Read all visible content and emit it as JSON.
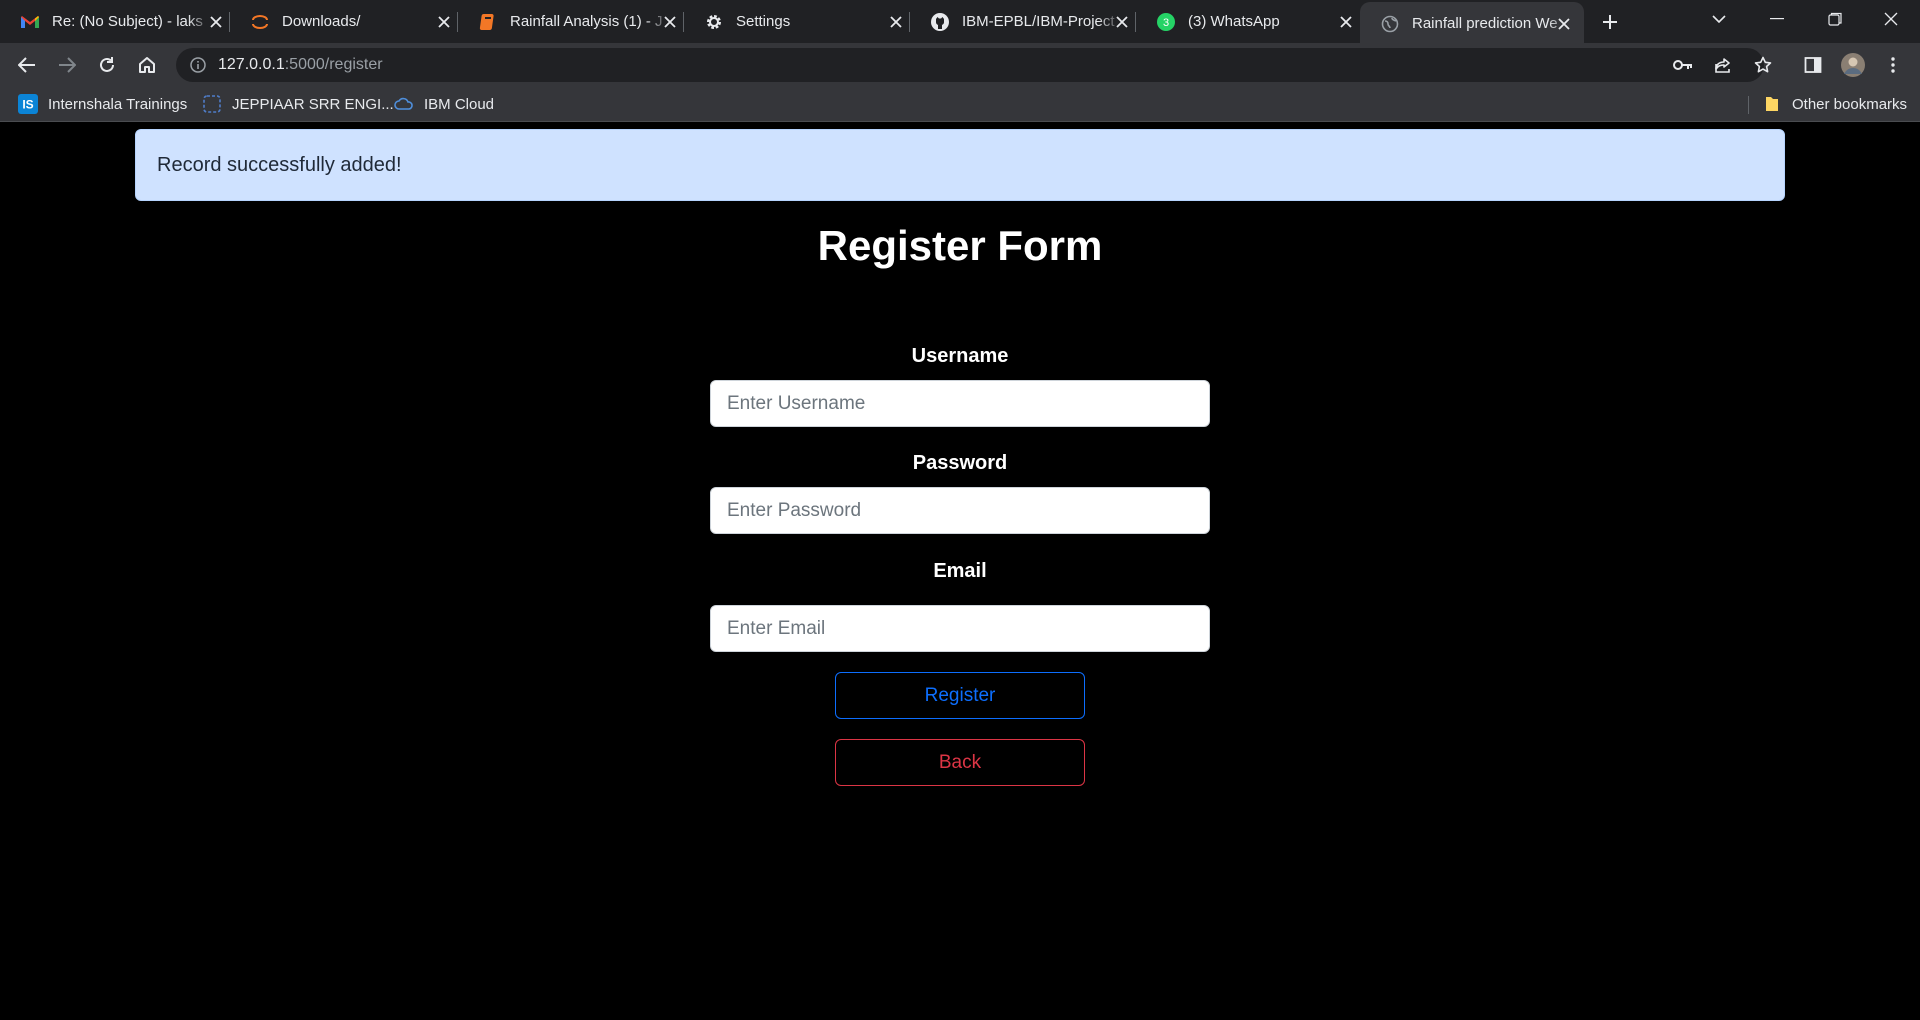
{
  "tabs": [
    {
      "title": "Re: (No Subject) - laks",
      "icon": "gmail-icon"
    },
    {
      "title": "Downloads/",
      "icon": "jupyter-icon"
    },
    {
      "title": "Rainfall Analysis (1) - J",
      "icon": "notebook-icon"
    },
    {
      "title": "Settings",
      "icon": "gear-icon"
    },
    {
      "title": "IBM-EPBL/IBM-Project",
      "icon": "github-icon"
    },
    {
      "title": "(3) WhatsApp",
      "icon": "whatsapp-icon",
      "badge": "3"
    },
    {
      "title": "Rainfall prediction We",
      "icon": "globe-icon",
      "active": true
    }
  ],
  "address_bar": {
    "host": "127.0.0.1",
    "path": ":5000/register"
  },
  "bookmarks": [
    {
      "label": "Internshala Trainings",
      "icon": "internshala-icon",
      "icon_text": "IS"
    },
    {
      "label": "JEPPIAAR SRR ENGI...",
      "icon": "site-icon"
    },
    {
      "label": "IBM Cloud",
      "icon": "ibm-cloud-icon"
    }
  ],
  "other_bookmarks": "Other bookmarks",
  "alert": {
    "message": "Record successfully added!"
  },
  "form": {
    "title": "Register Form",
    "username_label": "Username",
    "username_placeholder": "Enter Username",
    "password_label": "Password",
    "password_placeholder": "Enter Password",
    "email_label": "Email",
    "email_placeholder": "Enter Email",
    "register_label": "Register",
    "back_label": "Back"
  },
  "colors": {
    "page_background": "#000000",
    "alert_background": "#cfe2ff",
    "primary": "#0d6efd",
    "danger": "#dc3545"
  }
}
